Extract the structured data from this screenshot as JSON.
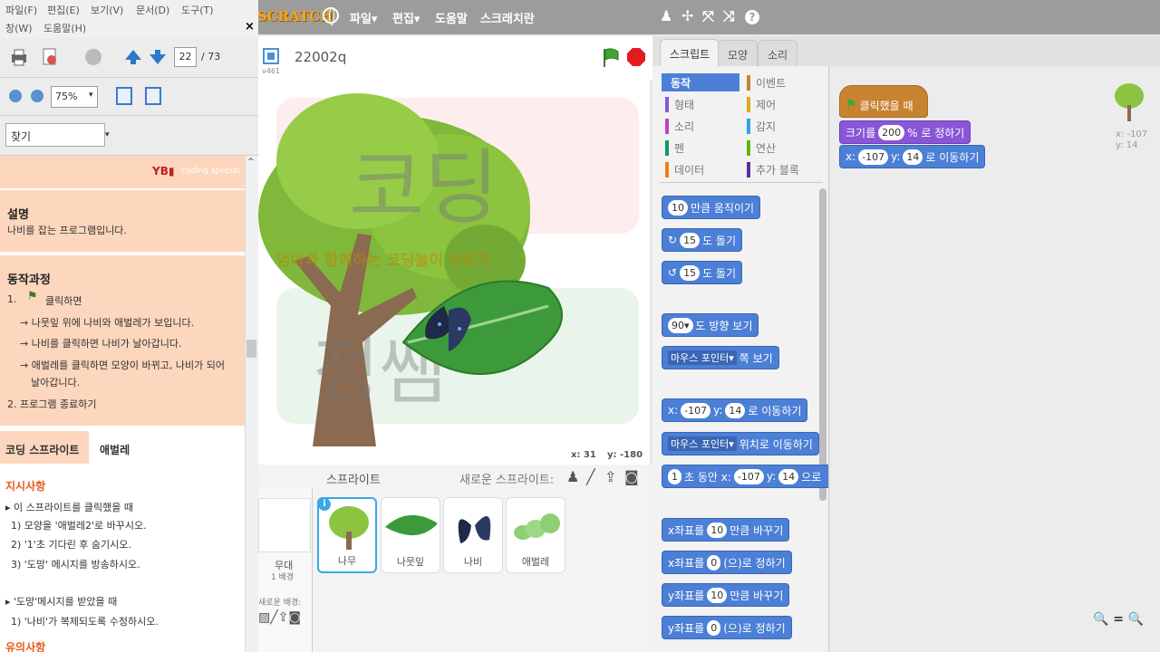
{
  "pdf": {
    "menu": [
      "파일(F)",
      "편집(E)",
      "보기(V)",
      "문서(D)",
      "도구(T)",
      "창(W)",
      "도움말(H)"
    ],
    "page_current": "22",
    "page_total": "/ 73",
    "zoom": "75%",
    "find_placeholder": "찾기",
    "watermark": "coding special",
    "desc_title": "설명",
    "desc_text": "나비를 잡는 프로그램입니다.",
    "process_title": "동작과정",
    "step1": "1.",
    "step1_text": "클릭하면",
    "step1a": "→ 나뭇잎 위에 나비와 애벌레가 보입니다.",
    "step1b": "→ 나비를 클릭하면 나비가 날아갑니다.",
    "step1c": "→ 애벌레를 클릭하면 모양이 바뀌고, 나비가 되어",
    "step1c2": "날아갑니다.",
    "step2": "2.  프로그램 종료하기",
    "tab_coding": "코딩 스프라이트",
    "tab_sprite": "애벌레",
    "instr_title": "지시사항",
    "instr1": "▸ 이 스프라이트를 클릭했을 때",
    "instr1_1": "1) 모양을 '애벌레2'로 바꾸시오.",
    "instr1_2": "2) '1'초 기다린 후 숨기시오.",
    "instr1_3": "3) '도망' 메시지를 방송하시오.",
    "instr2": "▸ '도망'메시지를 받았을 때",
    "instr2_1": "1) '나비'가 복제되도록 수정하시오.",
    "notes_title": "유의사항"
  },
  "scratch": {
    "logo": "SCRATCH",
    "menu": [
      "파일▾",
      "편집▾",
      "도움말",
      "스크래치란"
    ],
    "project_title": "22002q",
    "version": "v461",
    "stage_coords_x": "x: 31",
    "stage_coords_y": "y: -180",
    "stage_watermark_title": "코딩",
    "stage_watermark_sub": "엄마와 함께하는 코딩놀이 전문가",
    "stage_watermark_name": "정쌤",
    "sprites_label": "스프라이트",
    "new_sprite_label": "새로운 스프라이트:",
    "backdrop_name": "무대",
    "backdrop_count": "1 배경",
    "new_backdrop_label": "새로운 배경:",
    "sprites": [
      "나무",
      "나뭇잎",
      "나비",
      "애벌레"
    ],
    "tabs": [
      "스크립트",
      "모양",
      "소리"
    ],
    "categories_left": [
      "동작",
      "형태",
      "소리",
      "펜",
      "데이터"
    ],
    "categories_right": [
      "이벤트",
      "제어",
      "감지",
      "연산",
      "추가 블록"
    ],
    "blocks": {
      "move": [
        "10",
        "만큼 움직이기"
      ],
      "turn_cw": [
        "15",
        "도 돌기"
      ],
      "turn_ccw": [
        "15",
        "도 돌기"
      ],
      "point_dir": [
        "90▾",
        "도 방향 보기"
      ],
      "point_towards": [
        "마우스 포인터▾",
        "쪽 보기"
      ],
      "goto_xy": [
        "x:",
        "-107",
        "y:",
        "14",
        "로 이동하기"
      ],
      "goto": [
        "마우스 포인터▾",
        "위치로 이동하기"
      ],
      "glide": [
        "1",
        "초 동안 x:",
        "-107",
        "y:",
        "14",
        "으로"
      ],
      "change_x": [
        "x좌표를",
        "10",
        "만큼 바꾸기"
      ],
      "set_x": [
        "x좌표를",
        "0",
        "(으)로 정하기"
      ],
      "change_y": [
        "y좌표를",
        "10",
        "만큼 바꾸기"
      ],
      "set_y": [
        "y좌표를",
        "0",
        "(으)로 정하기"
      ]
    },
    "script": {
      "hat": "클릭했을 때",
      "size_a": "크기를",
      "size_v": "200",
      "size_b": "% 로 정하기",
      "goto_a": "x:",
      "goto_x": "-107",
      "goto_y_label": "y:",
      "goto_y": "14",
      "goto_b": "로 이동하기"
    },
    "sprite_x": "x: -107",
    "sprite_y": "y: 14",
    "zoom_controls": "🔍 = 🔍"
  },
  "colors": {
    "motion": "#4c7fd6",
    "looks": "#8a55d7",
    "events": "#c88330",
    "selected_cat": "#4c7fd6",
    "pdf_highlight": "#fcd6bd"
  }
}
